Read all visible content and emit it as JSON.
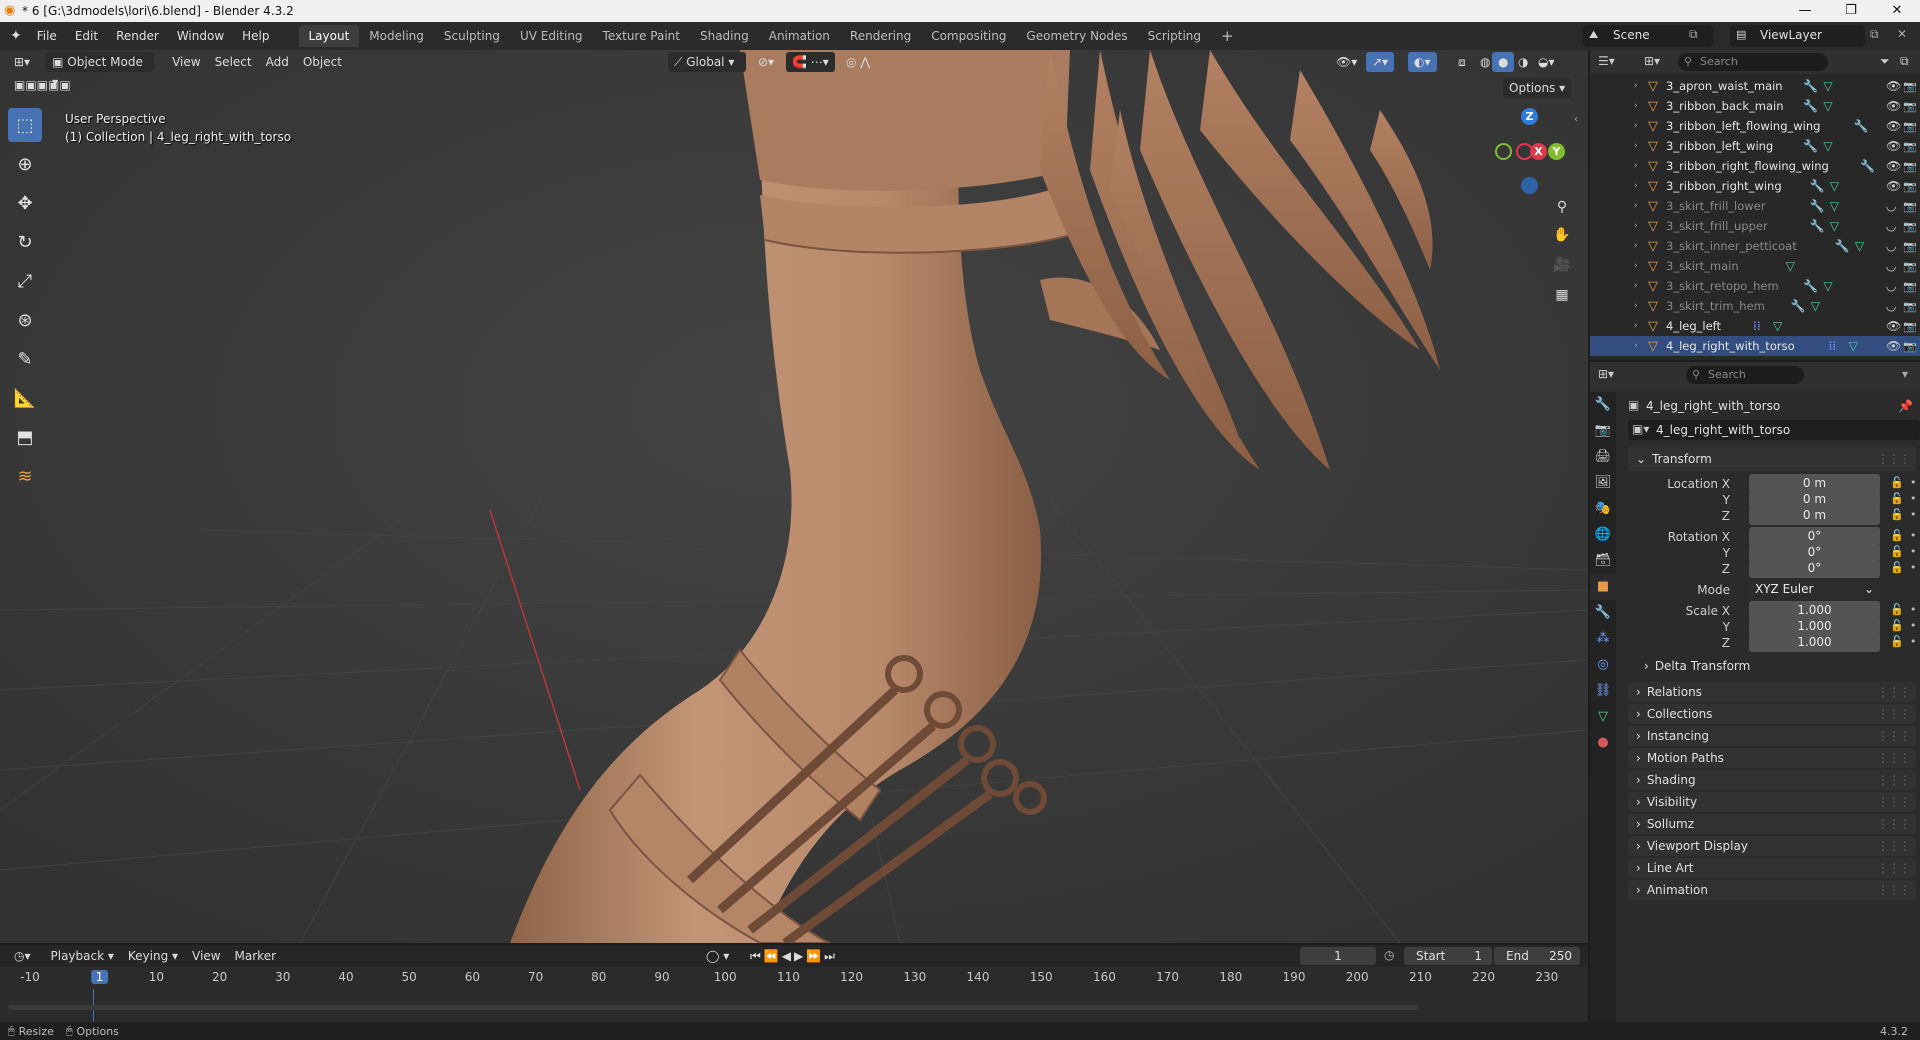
{
  "window": {
    "title": "* 6 [G:\\3dmodels\\lori\\6.blend] - Blender 4.3.2"
  },
  "menu": [
    "File",
    "Edit",
    "Render",
    "Window",
    "Help"
  ],
  "workspaces": [
    {
      "label": "Layout",
      "active": true
    },
    {
      "label": "Modeling"
    },
    {
      "label": "Sculpting"
    },
    {
      "label": "UV Editing"
    },
    {
      "label": "Texture Paint"
    },
    {
      "label": "Shading"
    },
    {
      "label": "Animation"
    },
    {
      "label": "Rendering"
    },
    {
      "label": "Compositing"
    },
    {
      "label": "Geometry Nodes"
    },
    {
      "label": "Scripting"
    }
  ],
  "add_workspace": "+",
  "scene": {
    "label": "Scene",
    "view_layer": "ViewLayer"
  },
  "viewport": {
    "mode": "Object Mode",
    "menus": [
      "View",
      "Select",
      "Add",
      "Object"
    ],
    "orientation": "Global",
    "options": "Options",
    "info_line1": "User Perspective",
    "info_line2": "(1) Collection | 4_leg_right_with_torso",
    "gizmo": {
      "z": "Z",
      "x": "X",
      "y": "Y"
    }
  },
  "outliner": {
    "search_placeholder": "Search",
    "rows": [
      {
        "name": "3_apron_waist_main",
        "dim": false,
        "mod": "🔧",
        "mesh": "▽"
      },
      {
        "name": "3_ribbon_back_main",
        "dim": false,
        "mod": "🔧",
        "mesh": "▽"
      },
      {
        "name": "3_ribbon_left_flowing_wing",
        "dim": false,
        "mod": "🔧",
        "mesh": ""
      },
      {
        "name": "3_ribbon_left_wing",
        "dim": false,
        "mod": "🔧",
        "mesh": "▽"
      },
      {
        "name": "3_ribbon_right_flowing_wing",
        "dim": false,
        "mod": "🔧",
        "mesh": ""
      },
      {
        "name": "3_ribbon_right_wing",
        "dim": false,
        "mod": "🔧",
        "mesh": "▽"
      },
      {
        "name": "3_skirt_frill_lower",
        "dim": true,
        "mod": "🔧",
        "mesh": "▽"
      },
      {
        "name": "3_skirt_frill_upper",
        "dim": true,
        "mod": "🔧",
        "mesh": "▽"
      },
      {
        "name": "3_skirt_inner_petticoat",
        "dim": true,
        "mod": "🔧",
        "mesh": "▽"
      },
      {
        "name": "3_skirt_main",
        "dim": true,
        "mod": "",
        "mesh": "▽"
      },
      {
        "name": "3_skirt_retopo_hem",
        "dim": true,
        "mod": "🔧",
        "mesh": "▽"
      },
      {
        "name": "3_skirt_trim_hem",
        "dim": true,
        "mod": "🔧",
        "mesh": "▽"
      },
      {
        "name": "4_leg_left",
        "dim": false,
        "mod": "⁞⁞",
        "mesh": "▽"
      },
      {
        "name": "4_leg_right_with_torso",
        "dim": false,
        "mod": "⁞⁞",
        "mesh": "▽"
      }
    ]
  },
  "properties": {
    "search_placeholder": "Search",
    "object_name": "4_leg_right_with_torso",
    "data_name": "4_leg_right_with_torso",
    "transform_label": "Transform",
    "location": {
      "label": "Location X",
      "x": "0 m",
      "y": "0 m",
      "z": "0 m"
    },
    "rotation": {
      "label": "Rotation X",
      "x": "0°",
      "y": "0°",
      "z": "0°"
    },
    "mode": {
      "label": "Mode",
      "value": "XYZ Euler"
    },
    "scale": {
      "label": "Scale X",
      "x": "1.000",
      "y": "1.000",
      "z": "1.000"
    },
    "axis_y": "Y",
    "axis_z": "Z",
    "delta_transform": "Delta Transform",
    "sections": [
      "Relations",
      "Collections",
      "Instancing",
      "Motion Paths",
      "Shading",
      "Visibility",
      "Sollumz",
      "Viewport Display",
      "Line Art",
      "Animation"
    ]
  },
  "timeline": {
    "menus": [
      "Playback",
      "Keying",
      "View",
      "Marker"
    ],
    "current_frame": "1",
    "start_label": "Start",
    "start": "1",
    "end_label": "End",
    "end": "250",
    "ticks": [
      "-10",
      "1",
      "10",
      "20",
      "30",
      "40",
      "50",
      "60",
      "70",
      "80",
      "90",
      "100",
      "110",
      "120",
      "130",
      "140",
      "150",
      "160",
      "170",
      "180",
      "190",
      "200",
      "210",
      "220",
      "230"
    ]
  },
  "status": {
    "resize": "Resize",
    "options": "Options",
    "version": "4.3.2"
  },
  "colors": {
    "accent": "#4772b3",
    "skin": "#b98a6d",
    "gizmo_x": "#e0394a",
    "gizmo_y": "#7fbf2e",
    "gizmo_z": "#2f7be0"
  }
}
